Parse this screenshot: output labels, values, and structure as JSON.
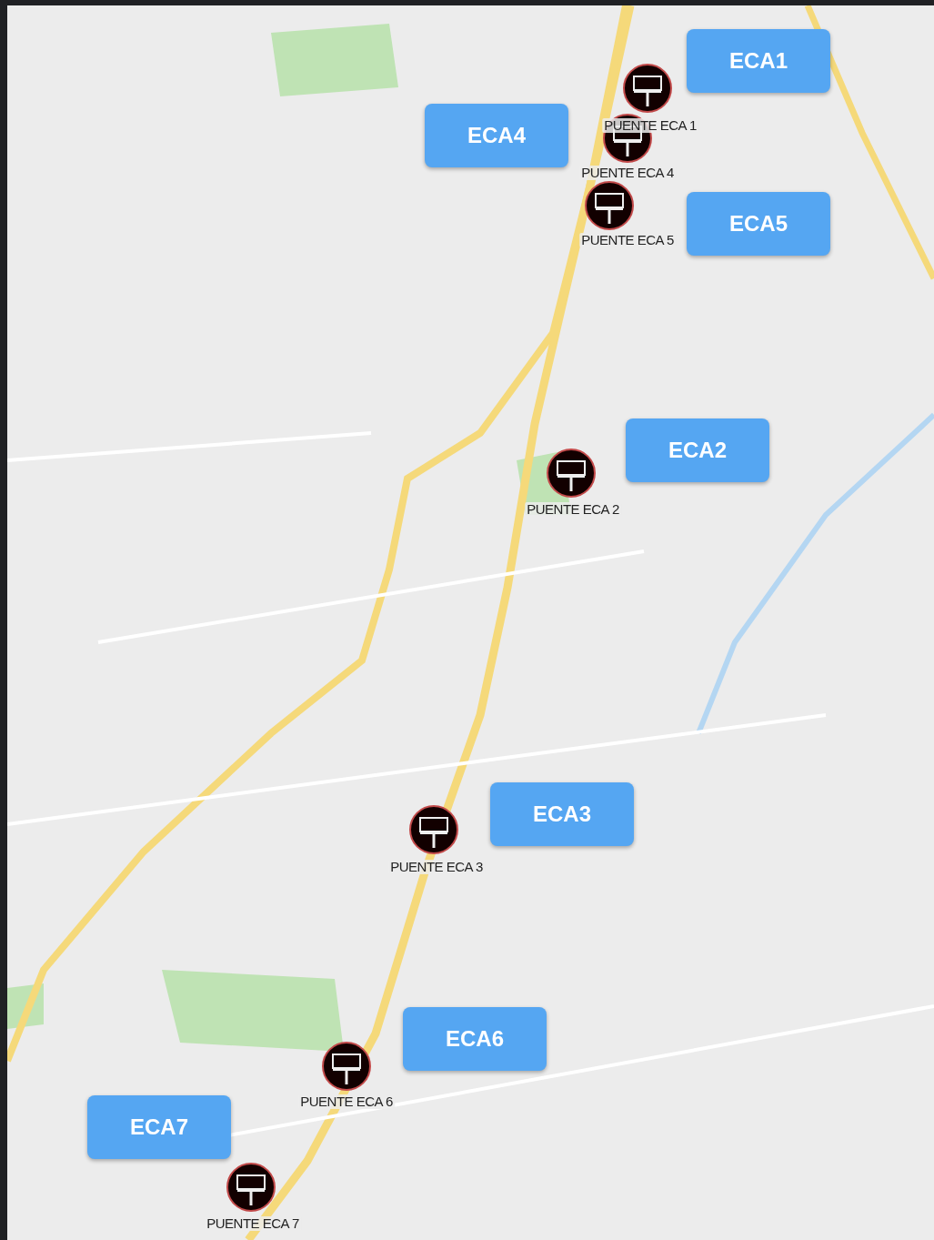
{
  "markers": [
    {
      "label": "PUENTE ECA 1"
    },
    {
      "label": "PUENTE ECA 4"
    },
    {
      "label": "PUENTE ECA 5"
    },
    {
      "label": "PUENTE ECA 2"
    },
    {
      "label": "PUENTE ECA 3"
    },
    {
      "label": "PUENTE ECA 6"
    },
    {
      "label": "PUENTE ECA 7"
    }
  ],
  "buttons": [
    {
      "label": "ECA1"
    },
    {
      "label": "ECA4"
    },
    {
      "label": "ECA5"
    },
    {
      "label": "ECA2"
    },
    {
      "label": "ECA3"
    },
    {
      "label": "ECA6"
    },
    {
      "label": "ECA7"
    }
  ]
}
